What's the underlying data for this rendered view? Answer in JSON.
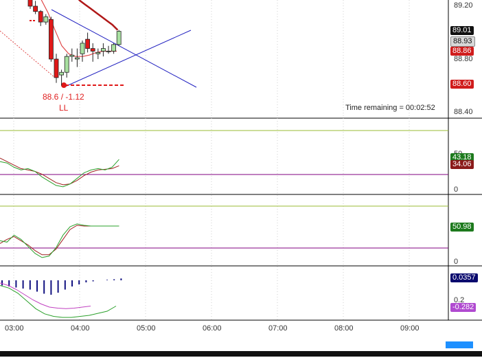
{
  "price_axis": {
    "ticks": [
      "89.20",
      "88.80",
      "88.40"
    ],
    "tags": [
      {
        "text": "89.01",
        "bg": "#111111",
        "fg": "#ffffff"
      },
      {
        "text": "88.93",
        "bg": "#d8d8d8",
        "fg": "#111111"
      },
      {
        "text": "88.86",
        "bg": "#d01c1c",
        "fg": "#ffffff"
      },
      {
        "text": "88.60",
        "bg": "#d01c1c",
        "fg": "#ffffff"
      }
    ]
  },
  "annotation": {
    "value": "88.6 / -1.12",
    "label": "LL",
    "color": "#e02020"
  },
  "time_remaining": "Time remaining = 00:02:52",
  "osc1": {
    "tick_50": "50",
    "tick_0": "0",
    "tags": [
      {
        "text": "43.18",
        "bg": "#1d7a1d",
        "fg": "#ffffff"
      },
      {
        "text": "34.06",
        "bg": "#8b1a1a",
        "fg": "#ffffff"
      }
    ]
  },
  "osc2": {
    "tick_0": "0",
    "tags": [
      {
        "text": "50.98",
        "bg": "#1d7a1d",
        "fg": "#ffffff"
      }
    ]
  },
  "osc3": {
    "tick": "0.2",
    "tags": [
      {
        "text": "0.0357",
        "bg": "#0a0a6e",
        "fg": "#ffffff"
      },
      {
        "text": "-0.282",
        "bg": "#b04ad0",
        "fg": "#ffffff"
      }
    ]
  },
  "time_axis": [
    "03:00",
    "04:00",
    "05:00",
    "06:00",
    "07:00",
    "08:00",
    "09:00"
  ],
  "colors": {
    "up_candle": "#a8e0a0",
    "down_candle": "#e01818",
    "trendline": "#2020c0",
    "ma_dark": "#b01818",
    "ma_light": "#e04848",
    "macd_bar": "#101080",
    "signal_green": "#2aa02a",
    "signal_red": "#a02020",
    "level_purple": "#800080",
    "level_olive": "#99bb33"
  },
  "chart_data": {
    "type": "candlestick",
    "candles": [
      {
        "o": 89.27,
        "h": 89.29,
        "l": 89.18,
        "c": 89.2
      },
      {
        "o": 89.2,
        "h": 89.24,
        "l": 89.14,
        "c": 89.16
      },
      {
        "o": 89.16,
        "h": 89.17,
        "l": 89.05,
        "c": 89.08
      },
      {
        "o": 89.08,
        "h": 89.14,
        "l": 89.06,
        "c": 89.12
      },
      {
        "o": 89.1,
        "h": 89.12,
        "l": 88.78,
        "c": 88.8
      },
      {
        "o": 88.8,
        "h": 88.84,
        "l": 88.62,
        "c": 88.66
      },
      {
        "o": 88.68,
        "h": 88.72,
        "l": 88.6,
        "c": 88.7
      },
      {
        "o": 88.7,
        "h": 88.84,
        "l": 88.66,
        "c": 88.82
      },
      {
        "o": 88.82,
        "h": 88.88,
        "l": 88.78,
        "c": 88.83
      },
      {
        "o": 88.8,
        "h": 88.88,
        "l": 88.74,
        "c": 88.81
      },
      {
        "o": 88.84,
        "h": 88.94,
        "l": 88.78,
        "c": 88.92
      },
      {
        "o": 88.95,
        "h": 89.0,
        "l": 88.85,
        "c": 88.88
      },
      {
        "o": 88.88,
        "h": 88.92,
        "l": 88.78,
        "c": 88.86
      },
      {
        "o": 88.84,
        "h": 88.88,
        "l": 88.8,
        "c": 88.85
      },
      {
        "o": 88.86,
        "h": 88.92,
        "l": 88.82,
        "c": 88.88
      },
      {
        "o": 88.86,
        "h": 88.9,
        "l": 88.84,
        "c": 88.86
      },
      {
        "o": 88.86,
        "h": 88.92,
        "l": 88.84,
        "c": 88.91
      },
      {
        "o": 88.91,
        "h": 89.02,
        "l": 88.9,
        "c": 89.01
      }
    ],
    "ma_dark": [
      89.5,
      89.45,
      89.4,
      89.36,
      89.32,
      89.28,
      89.24,
      89.21,
      89.18,
      89.15,
      89.12,
      89.09,
      89.06,
      89.02
    ],
    "ma_light": [
      89.25,
      89.15,
      89.02,
      88.9,
      88.84,
      88.82,
      88.82,
      88.83,
      88.85,
      88.86,
      88.86,
      88.86
    ],
    "osc1_green": [
      40,
      38,
      32,
      28,
      30,
      26,
      18,
      12,
      6,
      4,
      8,
      16,
      24,
      28,
      30,
      28,
      32,
      43
    ],
    "osc1_red": [
      45,
      40,
      35,
      30,
      28,
      26,
      22,
      16,
      10,
      7,
      8,
      13,
      20,
      25,
      28,
      29,
      30,
      34
    ],
    "osc2_green": [
      30,
      28,
      38,
      32,
      22,
      12,
      6,
      8,
      20,
      38,
      50,
      54,
      52,
      51,
      51,
      51,
      51,
      51
    ],
    "osc2_red": [
      26,
      32,
      36,
      30,
      24,
      16,
      10,
      10,
      18,
      32,
      46,
      52,
      51,
      51,
      51,
      51,
      51,
      51
    ],
    "macd_bars": [
      -0.1,
      -0.12,
      -0.14,
      -0.16,
      -0.18,
      -0.22,
      -0.26,
      -0.28,
      -0.24,
      -0.18,
      -0.12,
      -0.08,
      -0.04,
      -0.02,
      0.0,
      0.01,
      0.02,
      0.036
    ],
    "macd_green": [
      -0.1,
      -0.15,
      -0.25,
      -0.4,
      -0.55,
      -0.65,
      -0.7,
      -0.72,
      -0.72,
      -0.7,
      -0.68,
      -0.64,
      -0.6,
      -0.5
    ],
    "macd_purple": [
      -0.05,
      -0.1,
      -0.18,
      -0.28,
      -0.38,
      -0.46,
      -0.52,
      -0.54,
      -0.55,
      -0.54,
      -0.52,
      -0.5
    ]
  }
}
